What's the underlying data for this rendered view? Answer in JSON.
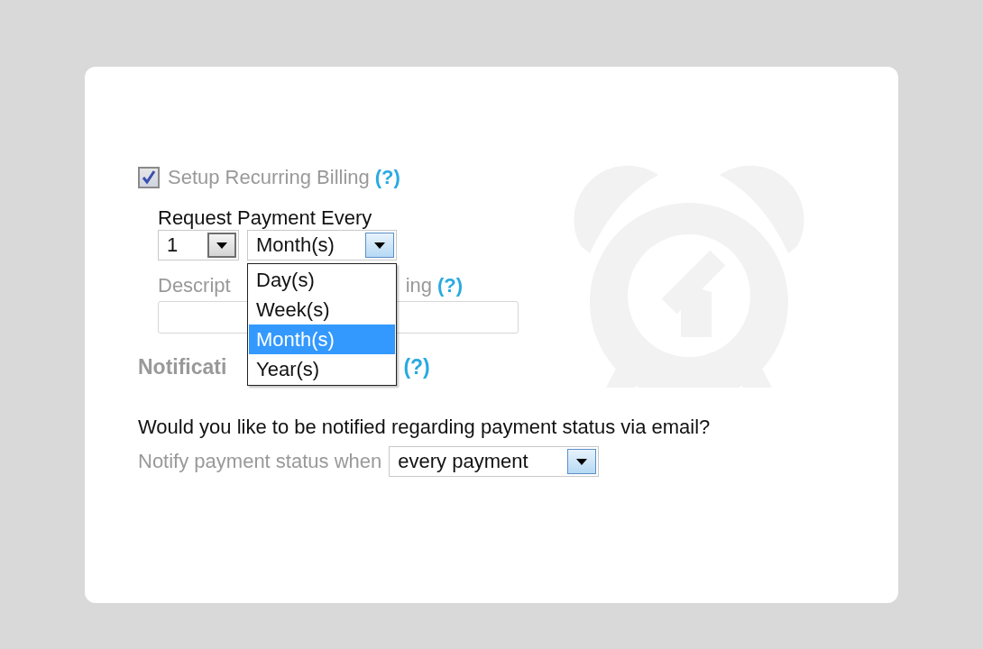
{
  "recurring": {
    "label": "Setup Recurring Billing",
    "checked": true,
    "help": "(?)",
    "interval_label": "Request Payment Every",
    "count_select": {
      "value": "1",
      "focused": false
    },
    "unit_select": {
      "value": "Month(s)",
      "focused": true,
      "expanded": true,
      "options": [
        {
          "label": "Day(s)",
          "selected": false
        },
        {
          "label": "Week(s)",
          "selected": false
        },
        {
          "label": "Month(s)",
          "selected": true
        },
        {
          "label": "Year(s)",
          "selected": false
        }
      ]
    },
    "description_label_parts": [
      "Descript",
      "ing"
    ],
    "description_help": "(?)"
  },
  "notification": {
    "heading": "Notificati",
    "help": "(?)",
    "question": "Would you like to be notified regarding payment status via email?",
    "when_label": "Notify payment status when",
    "when_select": {
      "value": "every payment",
      "focused": true
    }
  }
}
